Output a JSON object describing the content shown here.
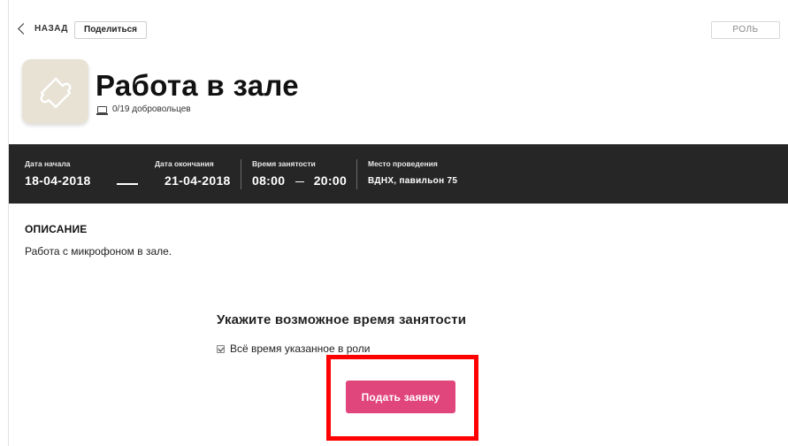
{
  "topbar": {
    "back_label": "НАЗАД",
    "share_label": "Поделиться",
    "role_label": "РОЛЬ"
  },
  "header": {
    "avatar_icon": "puzzle-piece-icon",
    "title": "Работа в зале",
    "volunteers_icon": "monitor-icon",
    "volunteers": "0/19 добровольцев"
  },
  "info": {
    "start_label": "Дата начала",
    "start_value": "18-04-2018",
    "end_label": "Дата окончания",
    "end_value": "21-04-2018",
    "time_label": "Время занятости",
    "time_from": "08:00",
    "time_to": "20:00",
    "place_label": "Место проведения",
    "place_value": "ВДНХ, павильон 75"
  },
  "description": {
    "heading": "ОПИСАНИЕ",
    "text": "Работа с микрофоном в зале."
  },
  "availability": {
    "heading": "Укажите возможное время занятости",
    "checkbox_label": "Всё время указанное в роли",
    "checkbox_checked": true,
    "submit_label": "Подать заявку"
  },
  "colors": {
    "accent": "#e0457b",
    "band": "#262626",
    "highlight": "#ff0000",
    "avatar_bg": "#e8e2d4"
  }
}
